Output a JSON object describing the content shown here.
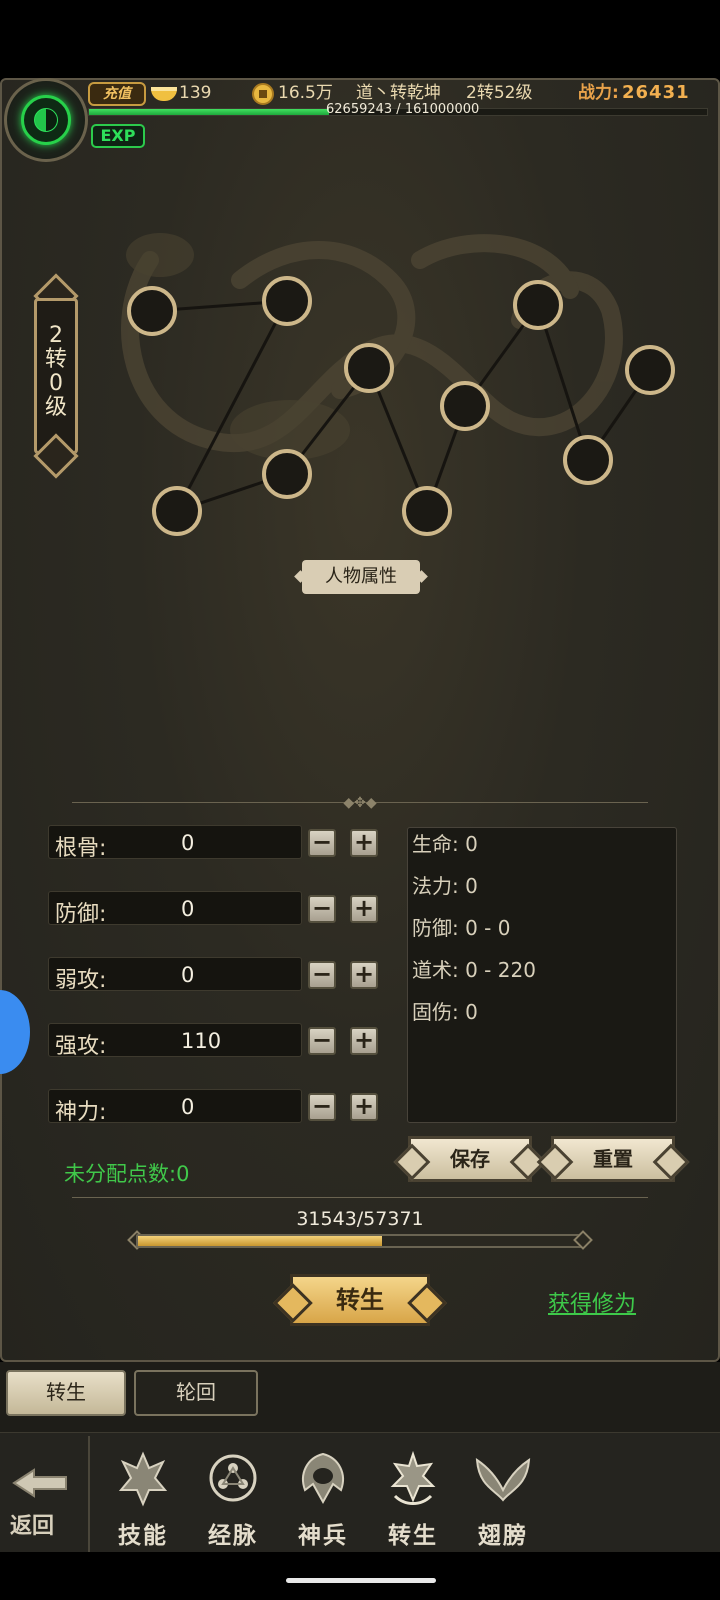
{
  "header": {
    "recharge_label": "充值",
    "ingot_count": "139",
    "coin_amount": "16.5万",
    "player_name": "道丶转乾坤",
    "player_level": "2转52级",
    "power_label": "战力:",
    "power_value": "26431",
    "exp_text": "62659243 / 161000000",
    "exp_fraction": 0.389,
    "exp_badge": "EXP"
  },
  "level_badge": {
    "line1": "2",
    "line2": "转",
    "line3": "0",
    "line4": "级"
  },
  "attributes_title": "人物属性",
  "stats": [
    {
      "label": "根骨:",
      "value": "0"
    },
    {
      "label": "防御:",
      "value": "0"
    },
    {
      "label": "弱攻:",
      "value": "0"
    },
    {
      "label": "强攻:",
      "value": "110"
    },
    {
      "label": "神力:",
      "value": "0"
    }
  ],
  "buttons": {
    "minus": "−",
    "plus": "+"
  },
  "results": [
    "生命: 0",
    "法力: 0",
    "防御: 0 - 0",
    "道术: 0 - 220",
    "固伤: 0"
  ],
  "unassigned_points": "未分配点数:0",
  "save_label": "保存",
  "reset_label": "重置",
  "progress": {
    "text": "31543/57371",
    "fraction": 0.55
  },
  "rebirth_label": "转生",
  "gain_link": "获得修为",
  "tabs": [
    {
      "label": "转生",
      "active": true
    },
    {
      "label": "轮回",
      "active": false
    }
  ],
  "nav": {
    "back_label": "返回",
    "items": [
      {
        "label": "技能",
        "icon": "skill-icon"
      },
      {
        "label": "经脉",
        "icon": "meridian-icon"
      },
      {
        "label": "神兵",
        "icon": "weapon-icon"
      },
      {
        "label": "转生",
        "icon": "rebirth-icon"
      },
      {
        "label": "翅膀",
        "icon": "wings-icon"
      }
    ]
  },
  "colors": {
    "accent_green": "#3ec94a",
    "gold": "#d8a548",
    "power": "#f2b050"
  }
}
